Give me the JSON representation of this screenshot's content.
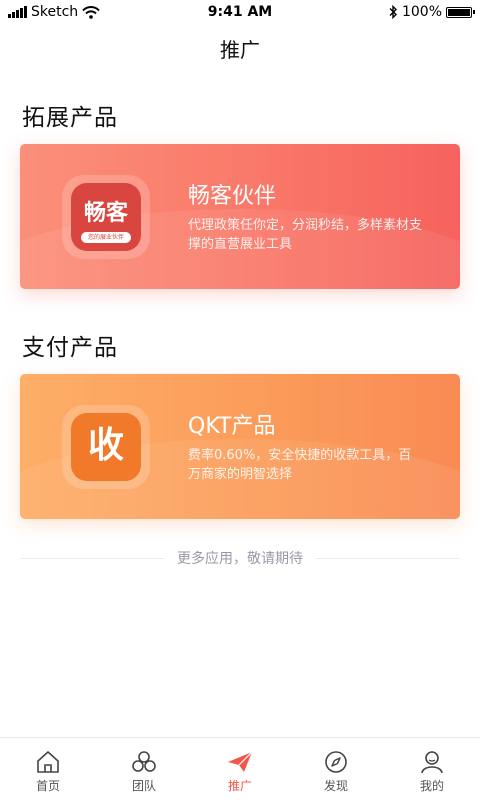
{
  "status_bar": {
    "carrier": "Sketch",
    "time": "9:41 AM",
    "battery": "100%"
  },
  "nav": {
    "title": "推广"
  },
  "sections": [
    {
      "title": "拓展产品",
      "card": {
        "title": "畅客伙伴",
        "description": "代理政策任你定，分润秒结，多样素材支撑的直营展业工具",
        "icon_text": "畅客",
        "icon_subtext": "您的展业伙伴",
        "icon": "changke-app-icon"
      }
    },
    {
      "title": "支付产品",
      "card": {
        "title": "QKT产品",
        "description": "费率0.60%，安全快捷的收款工具，百万商家的明智选择",
        "icon_text": "收",
        "icon": "shou-app-icon"
      }
    }
  ],
  "more_text": "更多应用，敬请期待",
  "tabs": [
    {
      "label": "首页",
      "icon": "home-icon",
      "active": false
    },
    {
      "label": "团队",
      "icon": "team-icon",
      "active": false
    },
    {
      "label": "推广",
      "icon": "paper-plane-icon",
      "active": true
    },
    {
      "label": "发现",
      "icon": "compass-icon",
      "active": false
    },
    {
      "label": "我的",
      "icon": "user-icon",
      "active": false
    }
  ],
  "colors": {
    "accent": "#f4574a",
    "card_red": "#f97869",
    "card_orange": "#fb9c5a"
  }
}
